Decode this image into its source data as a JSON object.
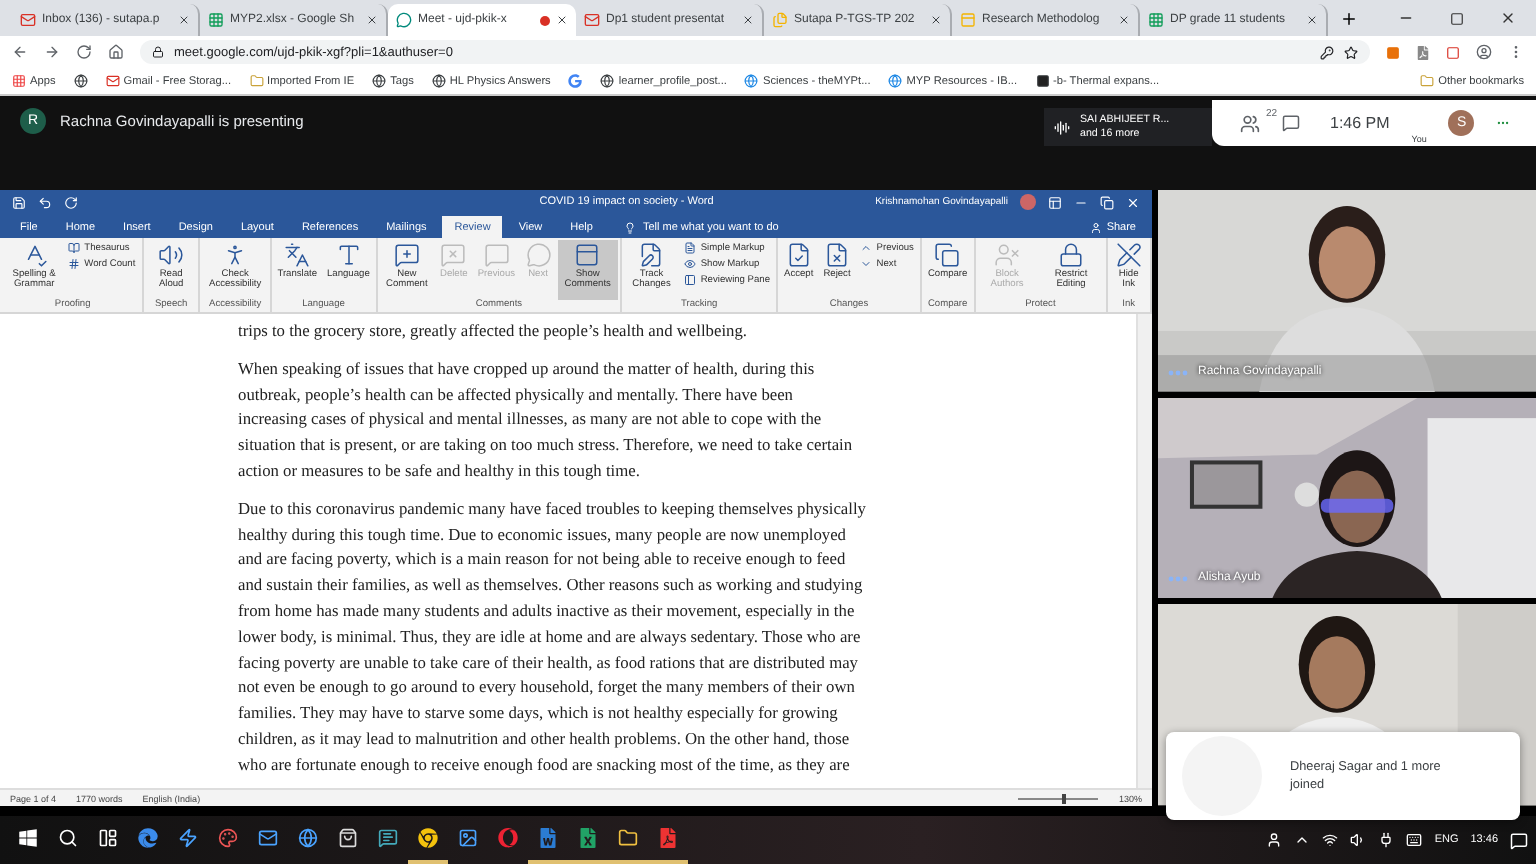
{
  "browser": {
    "tabs": [
      {
        "title": "Inbox (136) - sutapa.p",
        "kind": "gmail",
        "selected": false,
        "recording": false
      },
      {
        "title": "MYP2.xlsx - Google Sh",
        "kind": "sheets",
        "selected": false,
        "recording": false
      },
      {
        "title": "Meet - ujd-pkik-x",
        "kind": "meet",
        "selected": true,
        "recording": true
      },
      {
        "title": "Dp1 student presentat",
        "kind": "gmail",
        "selected": false,
        "recording": false
      },
      {
        "title": "Sutapa P-TGS-TP 202",
        "kind": "drive",
        "selected": false,
        "recording": false
      },
      {
        "title": "Research Methodolog",
        "kind": "slides",
        "selected": false,
        "recording": false
      },
      {
        "title": "DP grade 11 students",
        "kind": "sheets",
        "selected": false,
        "recording": false
      }
    ],
    "address": "meet.google.com/ujd-pkik-xgf?pli=1&authuser=0",
    "bookmarks": [
      {
        "label": "Apps",
        "kind": "apps"
      },
      {
        "kind": "globe"
      },
      {
        "label": "Gmail - Free Storag...",
        "kind": "gmail"
      },
      {
        "label": "Imported From IE",
        "kind": "folder"
      },
      {
        "label": "Tags",
        "kind": "globe"
      },
      {
        "label": "HL Physics Answers",
        "kind": "globe"
      },
      {
        "kind": "google"
      },
      {
        "label": "learner_profile_post...",
        "kind": "globe"
      },
      {
        "label": "Sciences - theMYPt...",
        "kind": "weebly"
      },
      {
        "label": "MYP Resources - IB...",
        "kind": "weebly"
      },
      {
        "label": "-b- Thermal expans...",
        "kind": "dark"
      },
      {
        "label": "Other bookmarks",
        "kind": "folder"
      }
    ]
  },
  "meet": {
    "presenter_initial": "R",
    "presenting": "Rachna Govindayapalli is presenting",
    "speaker": "SAI ABHIJEET R...",
    "speaker_more": "and 16 more",
    "people_count": "22",
    "time": "1:46 PM",
    "you_label": "You",
    "you_initial": "S"
  },
  "word": {
    "title": "COVID 19 impact on society  -  Word",
    "user": "Krishnamohan Govindayapalli",
    "tabs": [
      {
        "label": "File",
        "selected": false
      },
      {
        "label": "Home",
        "selected": false
      },
      {
        "label": "Insert",
        "selected": false
      },
      {
        "label": "Design",
        "selected": false
      },
      {
        "label": "Layout",
        "selected": false
      },
      {
        "label": "References",
        "selected": false
      },
      {
        "label": "Mailings",
        "selected": false
      },
      {
        "label": "Review",
        "selected": true
      },
      {
        "label": "View",
        "selected": false
      },
      {
        "label": "Help",
        "selected": false
      }
    ],
    "tell_me": "Tell me what you want to do",
    "share": "Share",
    "ribbon": [
      {
        "label": "Proofing",
        "items": [
          {
            "kind": "large",
            "label": "Spelling & Grammar",
            "disabled": false,
            "selected": false
          },
          {
            "kind": "small",
            "label": "Thesaurus",
            "disabled": false,
            "selected": false
          },
          {
            "kind": "small",
            "label": "Word Count",
            "disabled": false,
            "selected": false
          }
        ]
      },
      {
        "label": "Speech",
        "items": [
          {
            "kind": "large",
            "label": "Read Aloud",
            "disabled": false,
            "selected": false
          }
        ]
      },
      {
        "label": "Accessibility",
        "items": [
          {
            "kind": "large",
            "label": "Check Accessibility",
            "disabled": false,
            "selected": false
          }
        ]
      },
      {
        "label": "Language",
        "items": [
          {
            "kind": "large",
            "label": "Translate",
            "disabled": false,
            "selected": false
          },
          {
            "kind": "large",
            "label": "Language",
            "disabled": false,
            "selected": false
          }
        ]
      },
      {
        "label": "Comments",
        "items": [
          {
            "kind": "large",
            "label": "New Comment",
            "disabled": false,
            "selected": false
          },
          {
            "kind": "large",
            "label": "Delete",
            "disabled": true,
            "selected": false
          },
          {
            "kind": "large",
            "label": "Previous",
            "disabled": true,
            "selected": false
          },
          {
            "kind": "large",
            "label": "Next",
            "disabled": true,
            "selected": false
          },
          {
            "kind": "large",
            "label": "Show Comments",
            "disabled": false,
            "selected": true
          }
        ]
      },
      {
        "label": "Tracking",
        "items": [
          {
            "kind": "large",
            "label": "Track Changes",
            "disabled": false,
            "selected": false
          },
          {
            "kind": "small",
            "label": "Simple Markup",
            "disabled": false,
            "selected": false
          },
          {
            "kind": "small",
            "label": "Show Markup",
            "disabled": false,
            "selected": false
          },
          {
            "kind": "small",
            "label": "Reviewing Pane",
            "disabled": false,
            "selected": false
          }
        ]
      },
      {
        "label": "Changes",
        "items": [
          {
            "kind": "large",
            "label": "Accept",
            "disabled": false,
            "selected": false
          },
          {
            "kind": "large",
            "label": "Reject",
            "disabled": false,
            "selected": false
          },
          {
            "kind": "small",
            "label": "Previous",
            "disabled": false,
            "selected": false
          },
          {
            "kind": "small",
            "label": "Next",
            "disabled": false,
            "selected": false
          }
        ]
      },
      {
        "label": "Compare",
        "items": [
          {
            "kind": "large",
            "label": "Compare",
            "disabled": false,
            "selected": false
          }
        ]
      },
      {
        "label": "Protect",
        "items": [
          {
            "kind": "large",
            "label": "Block Authors",
            "disabled": true,
            "selected": false
          },
          {
            "kind": "large",
            "label": "Restrict Editing",
            "disabled": false,
            "selected": false
          }
        ]
      },
      {
        "label": "Ink",
        "items": [
          {
            "kind": "large",
            "label": "Hide Ink",
            "disabled": false,
            "selected": false
          }
        ]
      }
    ],
    "paragraphs": [
      [
        "trips to the grocery store, greatly affected the people’s health and wellbeing."
      ],
      [
        "When speaking of issues that have cropped up around the matter of health, during this",
        "outbreak, people’s health can be affected physically and mentally. There have been",
        "increasing cases of physical and mental illnesses, as many are not able to cope with the",
        "situation that is present, or are taking on too much stress. Therefore, we need to take certain",
        "action or measures to be safe and healthy in this tough time."
      ],
      [
        "Due to this coronavirus pandemic many have faced troubles to keeping themselves physically",
        "healthy during this tough time. Due to economic issues, many people are now unemployed",
        "and are facing poverty, which is a main reason for not being able to receive enough to feed",
        "and sustain their families, as well as themselves. Other reasons such as working and studying",
        "from home has made many students and adults inactive as their movement, especially in the",
        "lower body, is minimal. Thus, they are idle at home and are always sedentary. Those who are",
        "facing poverty are unable to take care of their health, as food rations that are distributed may",
        "not even be enough to go around to every household, forget the many members of their own",
        "families. They may have to starve some days, which is not healthy especially for growing",
        "children, as it may lead to malnutrition and other health problems. On the other hand, those",
        "who are fortunate enough to receive enough food are snacking most of the time, as they are"
      ]
    ],
    "status": {
      "page": "Page 1 of 4",
      "words": "1770 words",
      "language": "English (India)",
      "zoom": "130%",
      "zoom_slider": {
        "level": 0.55
      }
    }
  },
  "tiles": [
    {
      "kind": "picture",
      "name": "Rachna Govindayapalli"
    },
    {
      "kind": "picture",
      "name": "Alisha Ayub"
    },
    {
      "kind": "picture"
    }
  ],
  "toast": {
    "text": "Dheeraj Sagar and 1 more joined"
  },
  "taskbar": {
    "apps": [
      {
        "kind": "windows",
        "open": false
      },
      {
        "kind": "search",
        "open": false
      },
      {
        "kind": "taskview",
        "open": false
      },
      {
        "kind": "edge",
        "open": false
      },
      {
        "kind": "bolt",
        "open": false
      },
      {
        "kind": "paint",
        "open": false
      },
      {
        "kind": "mail",
        "open": false
      },
      {
        "kind": "globe",
        "open": false
      },
      {
        "kind": "store",
        "open": false
      },
      {
        "kind": "chat",
        "open": false
      },
      {
        "kind": "chrome",
        "open": true
      },
      {
        "kind": "photos",
        "open": false
      },
      {
        "kind": "opera",
        "open": false
      },
      {
        "kind": "word",
        "open": true
      },
      {
        "kind": "excel",
        "open": true
      },
      {
        "kind": "folder",
        "open": true
      },
      {
        "kind": "pdf",
        "open": true
      }
    ],
    "language": "ENG",
    "time": "13:46"
  }
}
